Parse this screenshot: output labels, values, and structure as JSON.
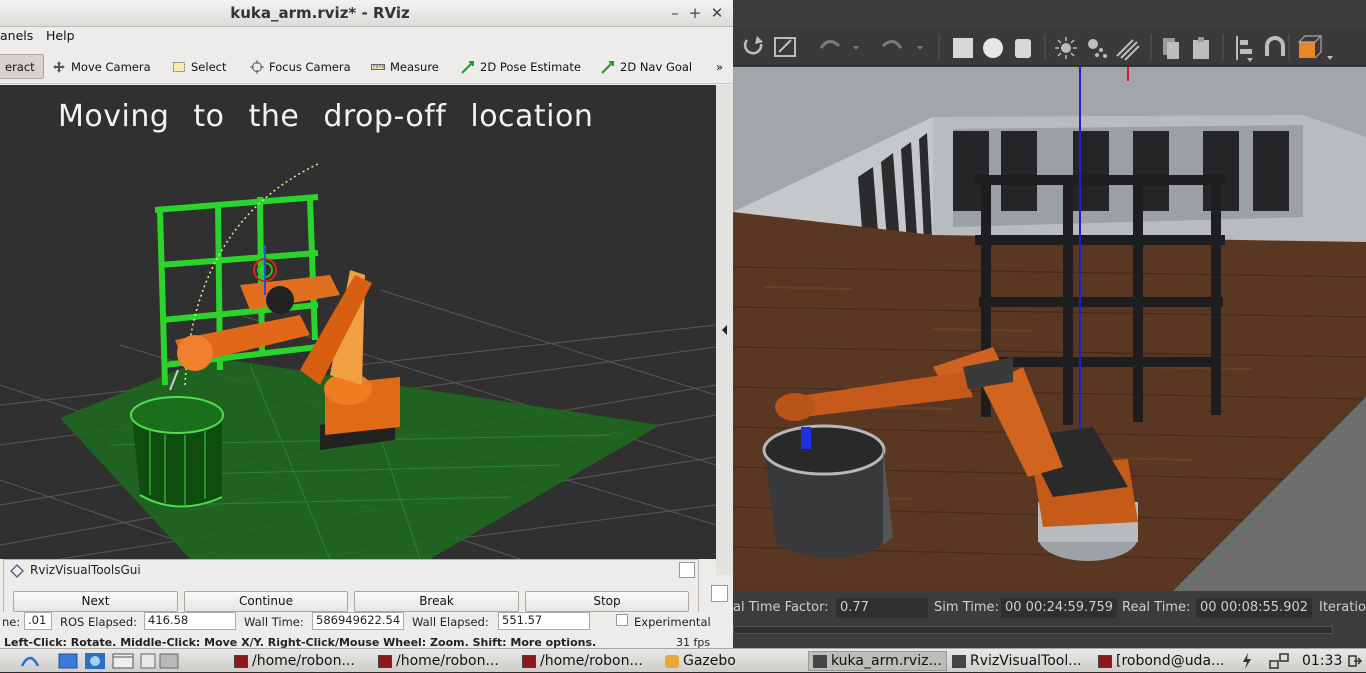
{
  "rviz": {
    "title": "kuka_arm.rviz* - RViz",
    "menu": [
      "anels",
      "Help"
    ],
    "toolbar": [
      {
        "label": "eract",
        "icon": "interact-icon"
      },
      {
        "label": "Move Camera",
        "icon": "move-camera-icon"
      },
      {
        "label": "Select",
        "icon": "select-icon"
      },
      {
        "label": "Focus Camera",
        "icon": "focus-camera-icon"
      },
      {
        "label": "Measure",
        "icon": "measure-icon"
      },
      {
        "label": "2D Pose Estimate",
        "icon": "pose-estimate-icon"
      },
      {
        "label": "2D Nav Goal",
        "icon": "nav-goal-icon"
      },
      {
        "label": "»",
        "icon": "more-icon"
      }
    ],
    "overlay_text": "Moving to the drop-off location",
    "visual_tools": {
      "title": "RvizVisualToolsGui",
      "buttons": [
        "Next",
        "Continue",
        "Break",
        "Stop"
      ]
    },
    "time_row": {
      "time_label": "ne:",
      "time_value": ".01",
      "ros_elapsed_label": "ROS Elapsed:",
      "ros_elapsed_value": "416.58",
      "wall_time_label": "Wall Time:",
      "wall_time_value": "586949622.54",
      "wall_elapsed_label": "Wall Elapsed:",
      "wall_elapsed_value": "551.57",
      "experimental_label": "Experimental"
    },
    "hint_row": {
      "text": "Left-Click: Rotate. Middle-Click: Move X/Y. Right-Click/Mouse Wheel: Zoom. Shift: More options.",
      "fps": "31 fps"
    }
  },
  "gazebo": {
    "status": {
      "rtf_label": "al Time Factor:",
      "rtf_value": "0.77",
      "sim_time_label": "Sim Time:",
      "sim_time_value": "00 00:24:59.759",
      "real_time_label": "Real Time:",
      "real_time_value": "00 00:08:55.902",
      "iterations_label": "Iteratio"
    }
  },
  "taskbar": {
    "items": [
      {
        "label": "/home/robon...",
        "icon": "terminal-icon"
      },
      {
        "label": "/home/robon...",
        "icon": "terminal-icon"
      },
      {
        "label": "/home/robon...",
        "icon": "terminal-icon"
      },
      {
        "label": "Gazebo",
        "icon": "gazebo-icon"
      },
      {
        "label": "kuka_arm.rviz...",
        "icon": "rviz-icon"
      },
      {
        "label": "RvizVisualTool...",
        "icon": "rviz-icon"
      },
      {
        "label": "[robond@uda...",
        "icon": "terminal-icon"
      }
    ],
    "clock": "01:33"
  }
}
